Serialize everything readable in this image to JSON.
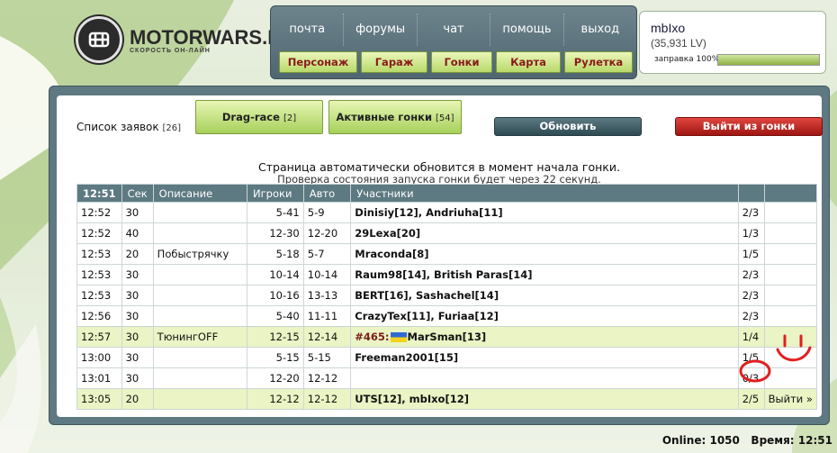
{
  "logo": {
    "name": "MOTORWARS.RU",
    "tagline": "СКОРОСТЬ ОН-ЛАЙН"
  },
  "topnav": {
    "links": [
      "почта",
      "форумы",
      "чат",
      "помощь",
      "выход"
    ],
    "buttons": [
      "Персонаж",
      "Гараж",
      "Гонки",
      "Карта",
      "Рулетка"
    ]
  },
  "user": {
    "name": "mbIxo",
    "lv": "(35,931 LV)",
    "fuel_label": "заправка 100%",
    "fuel_fraction": 1.0
  },
  "toolbar": {
    "requests_label": "Список заявок",
    "requests_count": "[26]",
    "drag_label": "Drag-race",
    "drag_count": "[2]",
    "active_label": "Активные гонки",
    "active_count": "[54]",
    "refresh_label": "Обновить",
    "leave_label": "Выйти из гонки"
  },
  "notice": {
    "line1": "Страница автоматически обновится в момент начала гонки.",
    "line2": "Проверка состояния запуска гонки будет через 22 секунд."
  },
  "table": {
    "headers": [
      "12:51",
      "Сек",
      "Описание",
      "Игроки",
      "Авто",
      "Участники",
      "",
      ""
    ],
    "rows": [
      {
        "time": "12:52",
        "sec": "30",
        "desc": "",
        "players": "5-41",
        "auto": "5-9",
        "prefix": "",
        "participants": "Dinisiy[12], Andriuha[11]",
        "count": "2/3",
        "action": "",
        "highlight": false
      },
      {
        "time": "12:52",
        "sec": "40",
        "desc": "",
        "players": "12-30",
        "auto": "12-20",
        "prefix": "",
        "participants": "29Lexa[20]",
        "count": "1/3",
        "action": "",
        "highlight": false
      },
      {
        "time": "12:53",
        "sec": "20",
        "desc": "Побыстрячку",
        "players": "5-18",
        "auto": "5-7",
        "prefix": "",
        "participants": "Mraconda[8]",
        "count": "1/5",
        "action": "",
        "highlight": false
      },
      {
        "time": "12:53",
        "sec": "30",
        "desc": "",
        "players": "10-14",
        "auto": "10-14",
        "prefix": "",
        "participants": "Raum98[14], British Paras[14]",
        "count": "2/3",
        "action": "",
        "highlight": false
      },
      {
        "time": "12:53",
        "sec": "30",
        "desc": "",
        "players": "10-16",
        "auto": "13-13",
        "prefix": "",
        "participants": "BERT[16], Sashachel[14]",
        "count": "2/3",
        "action": "",
        "highlight": false
      },
      {
        "time": "12:56",
        "sec": "30",
        "desc": "",
        "players": "5-40",
        "auto": "11-11",
        "prefix": "",
        "participants": "CrazyTex[11], Furiaa[12]",
        "count": "2/3",
        "action": "",
        "highlight": false
      },
      {
        "time": "12:57",
        "sec": "30",
        "desc": "ТюнингOFF",
        "players": "12-15",
        "auto": "12-14",
        "prefix": "#465:",
        "participants": "MarSman[13]",
        "count": "1/4",
        "action": "",
        "highlight": true
      },
      {
        "time": "13:00",
        "sec": "30",
        "desc": "",
        "players": "5-15",
        "auto": "5-15",
        "prefix": "",
        "participants": "Freeman2001[15]",
        "count": "1/5",
        "action": "",
        "highlight": false
      },
      {
        "time": "13:01",
        "sec": "30",
        "desc": "",
        "players": "12-20",
        "auto": "12-12",
        "prefix": "",
        "participants": "",
        "count": "0/3",
        "action": "",
        "highlight": false
      },
      {
        "time": "13:05",
        "sec": "20",
        "desc": "",
        "players": "12-12",
        "auto": "12-12",
        "prefix": "",
        "participants": "UTS[12], mbIxo[12]",
        "count": "2/5",
        "action": "Выйти »",
        "highlight": true
      }
    ]
  },
  "footer": {
    "online_label": "Online:",
    "online": "1050",
    "time_label": "Время:",
    "time": "12:51"
  },
  "colors": {
    "nav": "#5e7981",
    "accent_green": "#b8d96a",
    "danger": "#b21d17",
    "highlight_row": "#eaf4c4",
    "annotation": "#e02020"
  }
}
